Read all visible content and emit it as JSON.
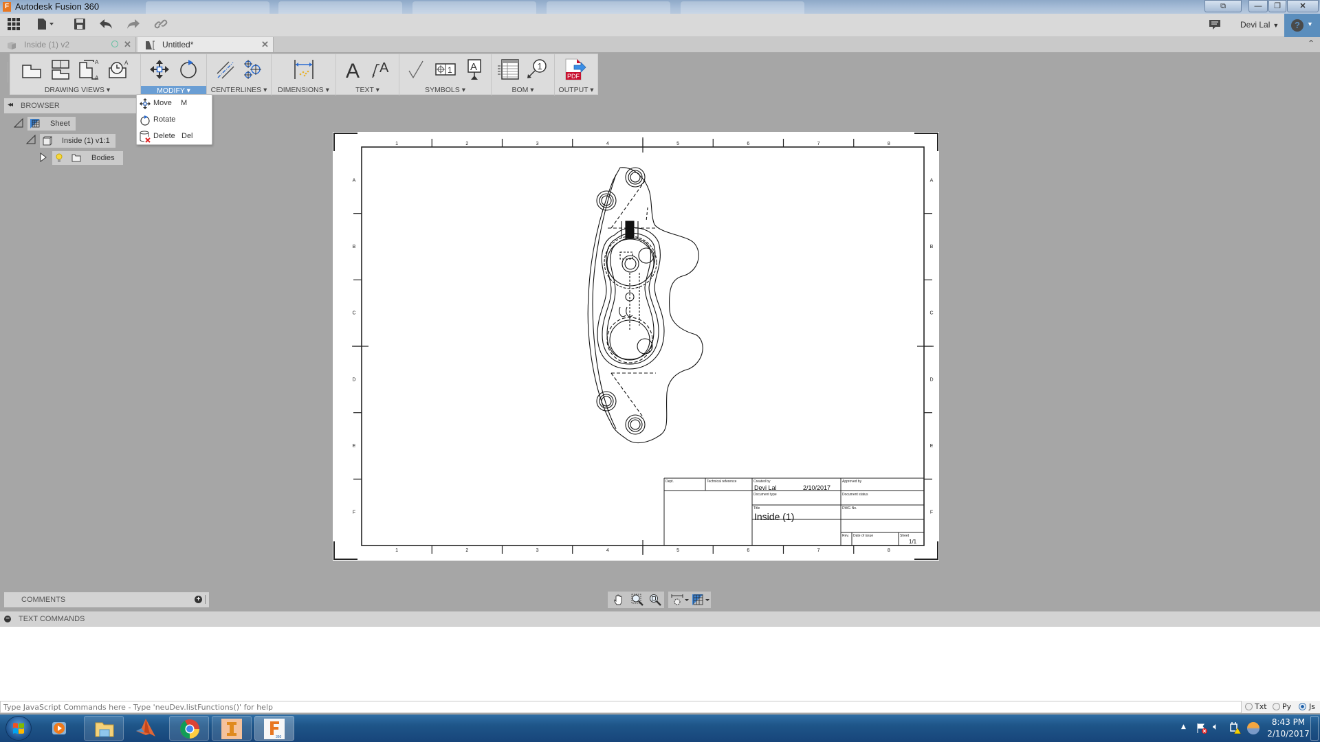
{
  "window": {
    "title": "Autodesk Fusion 360",
    "app_icon": "fusion-f-icon"
  },
  "quick_access": {
    "items": [
      "data-panel-grid-icon",
      "file-menu-icon",
      "save-icon",
      "undo-icon",
      "redo-icon",
      "link-icon"
    ],
    "notifications_icon": "comment-icon",
    "user_name": "Devi Lal",
    "help_icon": "help-icon"
  },
  "tabs": [
    {
      "label": "Inside (1) v2",
      "active": false,
      "icon": "cube-icon",
      "status_icon": "sync-circle-icon"
    },
    {
      "label": "Untitled*",
      "active": true,
      "icon": "drawing-icon"
    }
  ],
  "ribbon": {
    "groups": [
      {
        "label": "DRAWING VIEWS",
        "active": false,
        "tools": [
          "base-view-icon",
          "projected-view-icon",
          "section-view-icon",
          "detail-view-icon"
        ]
      },
      {
        "label": "MODIFY",
        "active": true,
        "tools": [
          "move-icon",
          "rotate-icon"
        ]
      },
      {
        "label": "CENTERLINES",
        "active": false,
        "tools": [
          "centerline-icon",
          "center-mark-icon"
        ]
      },
      {
        "label": "DIMENSIONS",
        "active": false,
        "tools": [
          "dimension-icon"
        ]
      },
      {
        "label": "TEXT",
        "active": false,
        "tools": [
          "text-icon",
          "leader-text-icon"
        ]
      },
      {
        "label": "SYMBOLS",
        "active": false,
        "tools": [
          "surface-texture-icon",
          "feature-control-frame-icon",
          "datum-identifier-icon"
        ]
      },
      {
        "label": "BOM",
        "active": false,
        "tools": [
          "table-icon",
          "balloon-icon"
        ]
      },
      {
        "label": "OUTPUT",
        "active": false,
        "tools": [
          "pdf-output-icon"
        ]
      }
    ]
  },
  "modify_menu": {
    "items": [
      {
        "label": "Move",
        "shortcut": "M",
        "icon": "move-icon"
      },
      {
        "label": "Rotate",
        "shortcut": "",
        "icon": "rotate-icon"
      },
      {
        "label": "Delete",
        "shortcut": "Del",
        "icon": "delete-icon"
      }
    ]
  },
  "browser": {
    "title": "BROWSER",
    "tree": [
      {
        "label": "Sheet",
        "level": 0,
        "expanded": true
      },
      {
        "label": "Inside (1) v1:1",
        "level": 1,
        "expanded": true
      },
      {
        "label": "Bodies",
        "level": 2,
        "expanded": false
      }
    ]
  },
  "sheet": {
    "column_labels": [
      "1",
      "2",
      "3",
      "4",
      "5",
      "6",
      "7",
      "8"
    ],
    "row_labels": [
      "A",
      "B",
      "C",
      "D",
      "E",
      "F"
    ],
    "title_block": {
      "dept_label": "Dept.",
      "tech_ref_label": "Technical reference",
      "created_by_label": "Created by",
      "created_by": "Devi Lal",
      "created_date": "2/10/2017",
      "approved_by_label": "Approved by",
      "doc_type_label": "Document type",
      "doc_status_label": "Document status",
      "title_label": "Title",
      "title": "Inside (1)",
      "dwg_no_label": "DWG No.",
      "rev_label": "Rev.",
      "date_of_issue_label": "Date of issue",
      "sheet_label": "Sheet",
      "sheet_value": "1/1"
    }
  },
  "comments": {
    "label": "COMMENTS"
  },
  "nav_bar": {
    "tools": [
      "pan-icon",
      "zoom-window-icon",
      "zoom-fit-icon",
      "sheet-settings-icon",
      "grid-display-icon"
    ]
  },
  "text_commands": {
    "label": "TEXT COMMANDS",
    "input_placeholder": "Type JavaScript Commands here - Type 'neuDev.listFunctions()' for help",
    "modes": [
      {
        "label": "Txt",
        "selected": false
      },
      {
        "label": "Py",
        "selected": false
      },
      {
        "label": "Js",
        "selected": true
      }
    ]
  },
  "taskbar": {
    "apps": [
      "windows-start-icon",
      "media-player-icon",
      "file-explorer-icon",
      "matlab-icon",
      "chrome-icon",
      "inventor-icon",
      "fusion360-icon"
    ],
    "tray_icons": [
      "show-hidden-icons",
      "action-center-flag-icon",
      "volume-icon",
      "network-warning-icon",
      "app-tray-icon"
    ],
    "time": "8:43 PM",
    "date": "2/10/2017"
  },
  "colors": {
    "accent": "#6a9ed4",
    "help_bg": "#5b8ebd",
    "canvas_bg": "#a6a6a6",
    "taskbar": "#1e5588",
    "fusion_orange": "#e87722"
  }
}
